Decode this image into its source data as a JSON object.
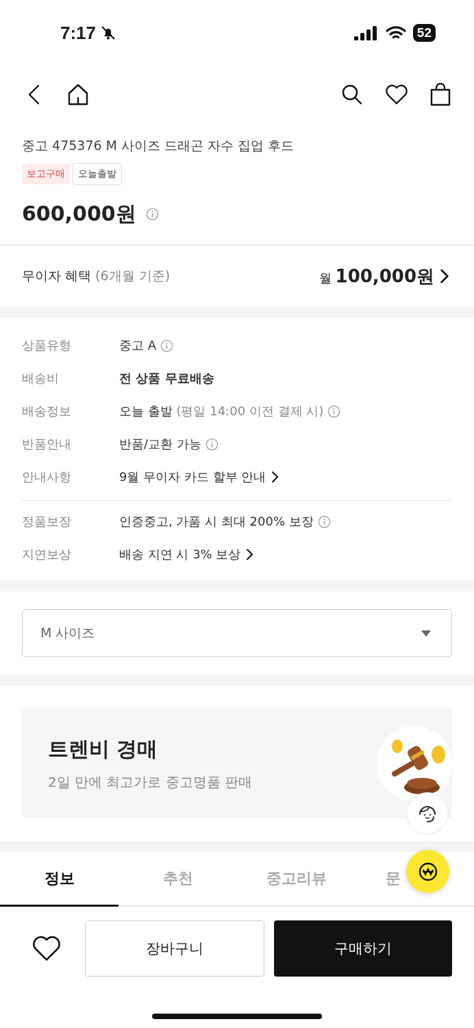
{
  "status_bar": {
    "time": "7:17",
    "battery": "52"
  },
  "product": {
    "title": "중고 475376 M 사이즈 드래곤 자수 집업 후드",
    "tags": [
      {
        "label": "보고구매",
        "kind": "red"
      },
      {
        "label": "오늘출발",
        "kind": "outline"
      }
    ],
    "price": "600,000원"
  },
  "installment": {
    "label": "무이자 혜택",
    "note": "(6개월 기준)",
    "prefix": "월",
    "amount": "100,000원"
  },
  "details": [
    [
      {
        "label": "상품유형",
        "value": "중고 A",
        "kind": "info"
      },
      {
        "label": "배송비",
        "value": "전 상품 무료배송",
        "kind": "emphasis"
      },
      {
        "label": "배송정보",
        "value": "오늘 출발",
        "note": "(평일 14:00 이전 결제 시)",
        "kind": "info"
      },
      {
        "label": "반품안내",
        "value": "반품/교환 가능",
        "kind": "info"
      },
      {
        "label": "안내사항",
        "value": "9월 무이자 카드 할부 안내",
        "kind": "link"
      }
    ],
    [
      {
        "label": "정품보장",
        "value": "인증중고, 가품 시 최대 200% 보장",
        "kind": "info"
      },
      {
        "label": "지연보상",
        "value": "배송 지연 시 3% 보상",
        "kind": "link"
      }
    ]
  ],
  "size_select": {
    "value": "M 사이즈"
  },
  "banner": {
    "title": "트렌비 경매",
    "subtitle": "2일 만에 최고가로 중고명품 판매"
  },
  "tabs": [
    {
      "label": "정보",
      "selected": true
    },
    {
      "label": "추천",
      "selected": false
    },
    {
      "label": "중고리뷰",
      "selected": false
    },
    {
      "label": "문",
      "selected": false
    }
  ],
  "bottom_bar": {
    "cart": "장바구니",
    "buy": "구매하기"
  }
}
